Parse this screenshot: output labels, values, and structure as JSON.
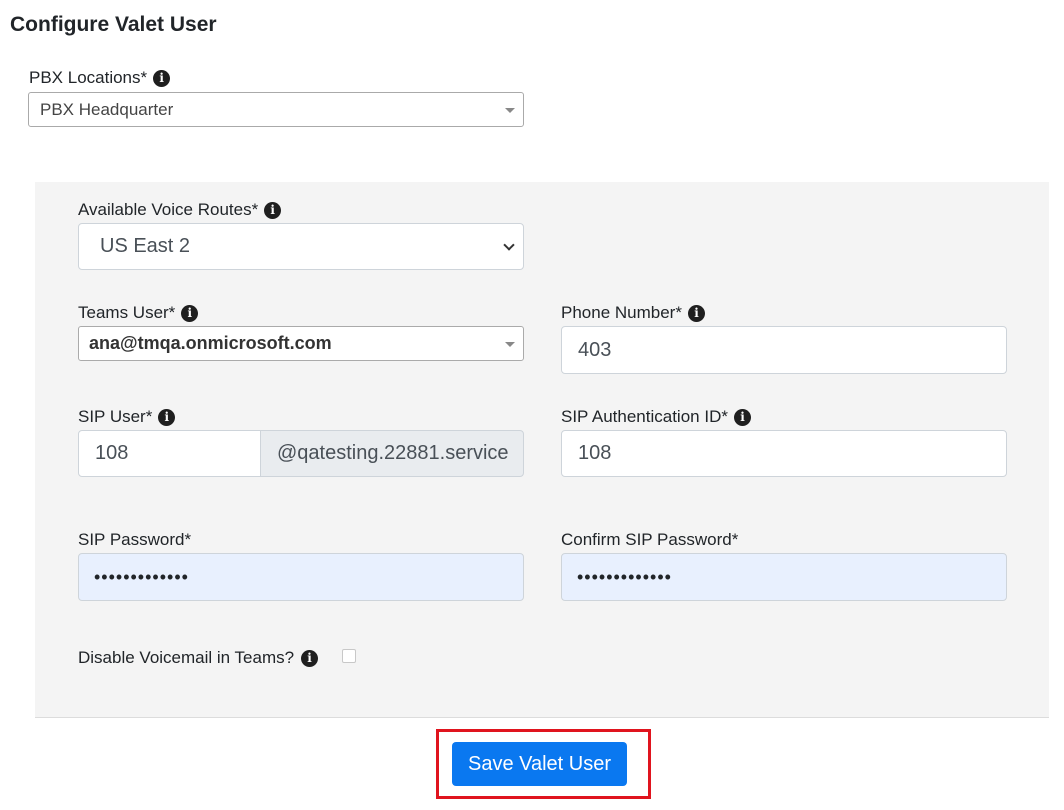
{
  "page": {
    "title": "Configure Valet User"
  },
  "pbx_locations": {
    "label": "PBX Locations*",
    "value": "PBX Headquarter"
  },
  "voice_routes": {
    "label": "Available Voice Routes*",
    "value": "US East 2"
  },
  "teams_user": {
    "label": "Teams User*",
    "value": "ana@tmqa.onmicrosoft.com"
  },
  "phone_number": {
    "label": "Phone Number*",
    "value": "403"
  },
  "sip_user": {
    "label": "SIP User*",
    "value": "108",
    "suffix": "@qatesting.22881.service"
  },
  "sip_auth_id": {
    "label": "SIP Authentication ID*",
    "value": "108"
  },
  "sip_password": {
    "label": "SIP Password*",
    "masked": "•••••••••••••"
  },
  "confirm_sip_password": {
    "label": "Confirm SIP Password*",
    "masked": "•••••••••••••"
  },
  "disable_voicemail": {
    "label": "Disable Voicemail in Teams?",
    "checked": false
  },
  "actions": {
    "save_label": "Save Valet User"
  },
  "icons": {
    "info": "i"
  },
  "colors": {
    "primary": "#0a78f0",
    "highlight": "#e0141e",
    "autofill": "#e8f0fe"
  }
}
